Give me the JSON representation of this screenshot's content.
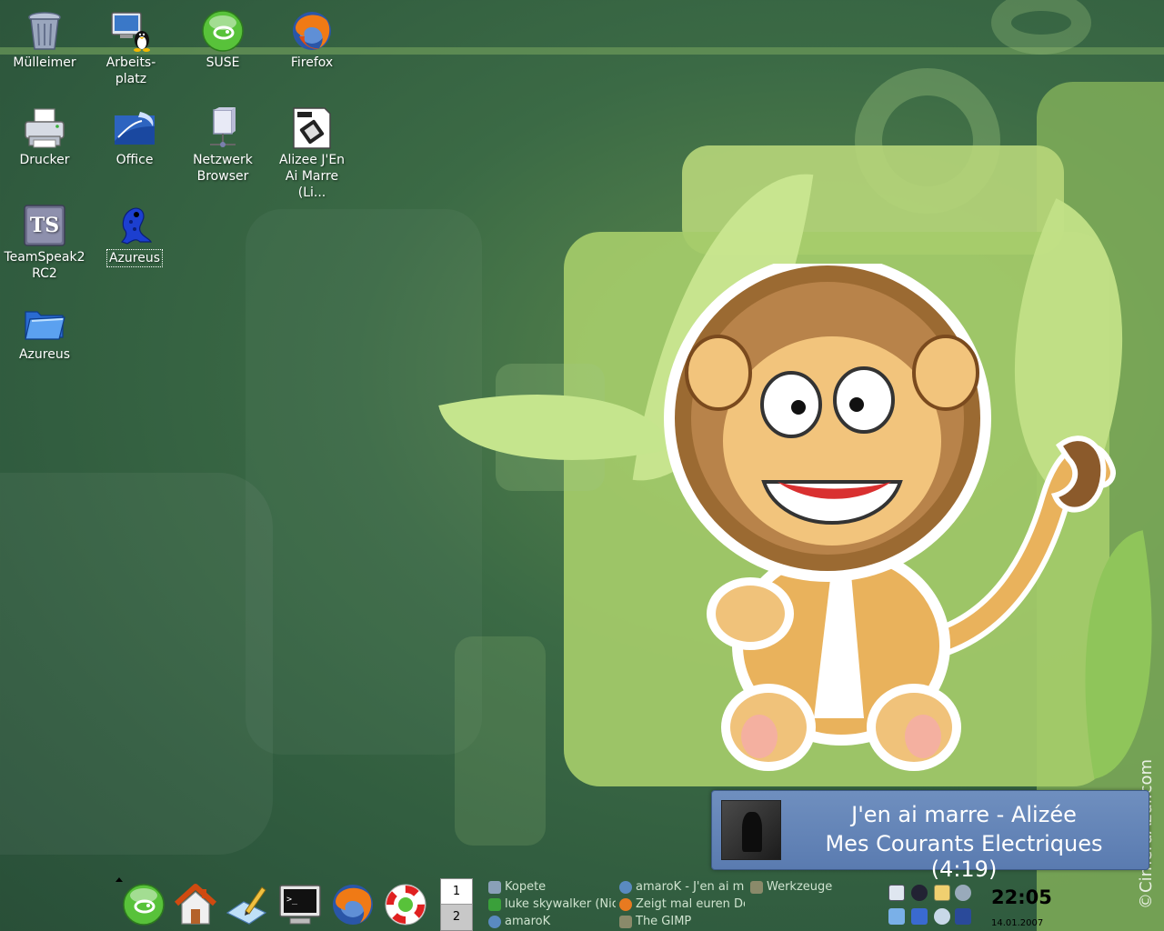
{
  "desktop": {
    "icons": [
      {
        "label": "Mülleimer",
        "icon": "trash-icon"
      },
      {
        "label": "Arbeits-\nplatz",
        "icon": "workstation-icon"
      },
      {
        "label": "SUSE",
        "icon": "suse-icon"
      },
      {
        "label": "Firefox",
        "icon": "firefox-icon"
      },
      {
        "label": "Drucker",
        "icon": "printer-icon"
      },
      {
        "label": "Office",
        "icon": "office-icon"
      },
      {
        "label": "Netzwerk\nBrowser",
        "icon": "network-browser-icon"
      },
      {
        "label": "Alizee J'En\nAi Marre (Li...",
        "icon": "video-file-icon"
      },
      {
        "label": "TeamSpeak2\nRC2",
        "icon": "teamspeak-icon"
      },
      {
        "label": "Azureus",
        "icon": "azureus-frog-icon"
      },
      {
        "label": "Azureus",
        "icon": "folder-icon"
      }
    ]
  },
  "wallpaper": {
    "credit": "©CimerdAzul.com"
  },
  "osd": {
    "line1": "J'en ai marre - Alizée",
    "line2": "Mes Courants Electriques (4:19)"
  },
  "panel": {
    "launchers": [
      "suse-menu-icon",
      "home-icon",
      "editor-icon",
      "terminal-icon",
      "firefox-icon",
      "help-icon"
    ],
    "pager": [
      "1",
      "2"
    ],
    "tasks": [
      {
        "label": "Kopete",
        "icon": "kopete-icon"
      },
      {
        "label": "luke skywalker (Nic",
        "icon": "kopete-chat-icon"
      },
      {
        "label": "amaroK",
        "icon": "amarok-icon"
      },
      {
        "label": "amaroK - J'en ai ma",
        "icon": "amarok-icon"
      },
      {
        "label": "Zeigt mal euren De",
        "icon": "firefox-icon"
      },
      {
        "label": "The GIMP",
        "icon": "gimp-icon"
      },
      {
        "label": "Werkzeuge",
        "icon": "gimp-tools-icon"
      }
    ],
    "clock": {
      "time": "22:05",
      "date": "14.01.2007"
    }
  },
  "colors": {
    "osd_background": "#5a7bb0",
    "desktop_green": "#2f5a3e",
    "wallpaper_lime": "#a5cc6a"
  }
}
